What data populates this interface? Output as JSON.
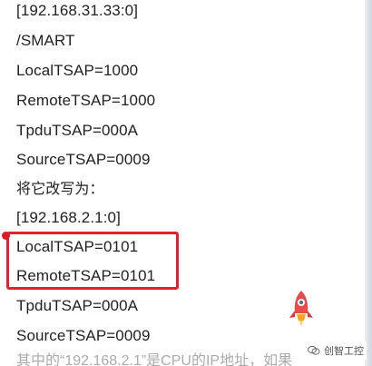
{
  "lines": [
    "[192.168.31.33:0]",
    "/SMART",
    "LocalTSAP=1000",
    "RemoteTSAP=1000",
    "TpduTSAP=000A",
    "SourceTSAP=0009",
    "将它改写为：",
    "[192.168.2.1:0]",
    "LocalTSAP=0101",
    "RemoteTSAP=0101",
    "TpduTSAP=000A",
    "SourceTSAP=0009"
  ],
  "partial_bottom_text": "其中的“192.168.2.1”是CPU的IP地址，如果",
  "watermark": {
    "label": "创智工控"
  },
  "colors": {
    "highlight": "#e1222a",
    "text": "#222222"
  },
  "icons": {
    "rocket": "rocket-icon",
    "wechat": "wechat-icon"
  }
}
